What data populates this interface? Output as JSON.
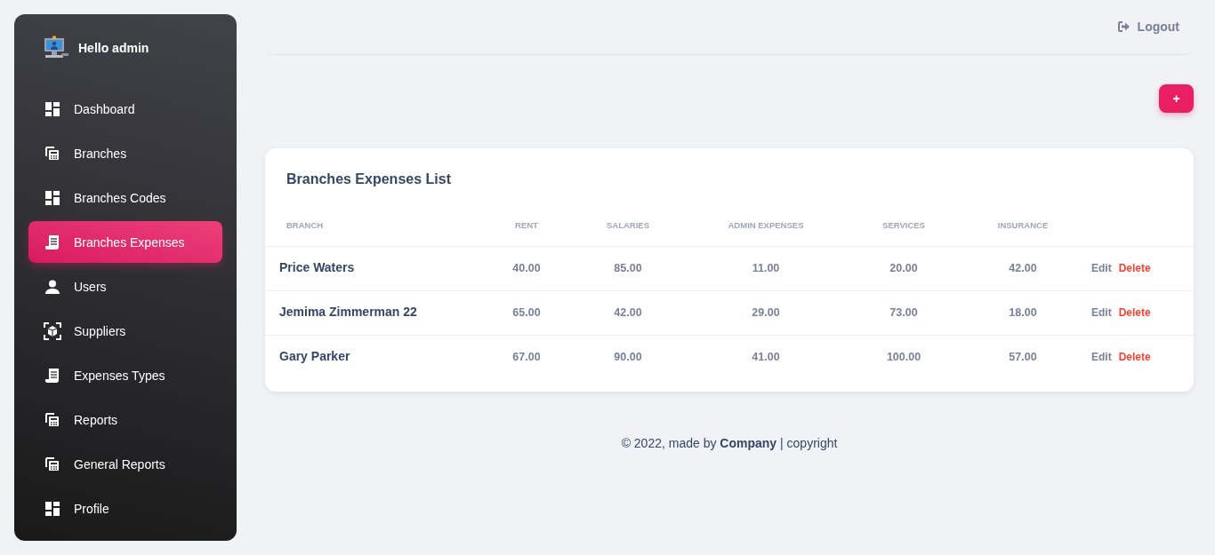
{
  "sidebar": {
    "greeting": "Hello admin",
    "items": [
      {
        "label": "Dashboard",
        "kind": "grid",
        "selected": false
      },
      {
        "label": "Branches",
        "kind": "calculator",
        "selected": false
      },
      {
        "label": "Branches Codes",
        "kind": "grid",
        "selected": false
      },
      {
        "label": "Branches Expenses",
        "kind": "receipt",
        "selected": true
      },
      {
        "label": "Users",
        "kind": "user",
        "selected": false
      },
      {
        "label": "Suppliers",
        "kind": "box",
        "selected": false
      },
      {
        "label": "Expenses Types",
        "kind": "receipt",
        "selected": false
      },
      {
        "label": "Reports",
        "kind": "calculator",
        "selected": false
      },
      {
        "label": "General Reports",
        "kind": "calculator",
        "selected": false
      },
      {
        "label": "Profile",
        "kind": "grid",
        "selected": false
      }
    ]
  },
  "header": {
    "logout": "Logout"
  },
  "add_button": "+",
  "table": {
    "title": "Branches Expenses List",
    "columns": [
      "BRANCH",
      "RENT",
      "SALARIES",
      "ADMIN EXPENSES",
      "SERVICES",
      "INSURANCE"
    ],
    "rows": [
      {
        "branch": "Price Waters",
        "values": [
          "40.00",
          "85.00",
          "11.00",
          "20.00",
          "42.00"
        ],
        "edit": "Edit",
        "delete": "Delete"
      },
      {
        "branch": "Jemima Zimmerman 22",
        "values": [
          "65.00",
          "42.00",
          "29.00",
          "73.00",
          "18.00"
        ],
        "edit": "Edit",
        "delete": "Delete"
      },
      {
        "branch": "Gary Parker",
        "values": [
          "67.00",
          "90.00",
          "41.00",
          "100.00",
          "57.00"
        ],
        "edit": "Edit",
        "delete": "Delete"
      }
    ]
  },
  "footer": "© 2022, made by **Company** | copyright"
}
